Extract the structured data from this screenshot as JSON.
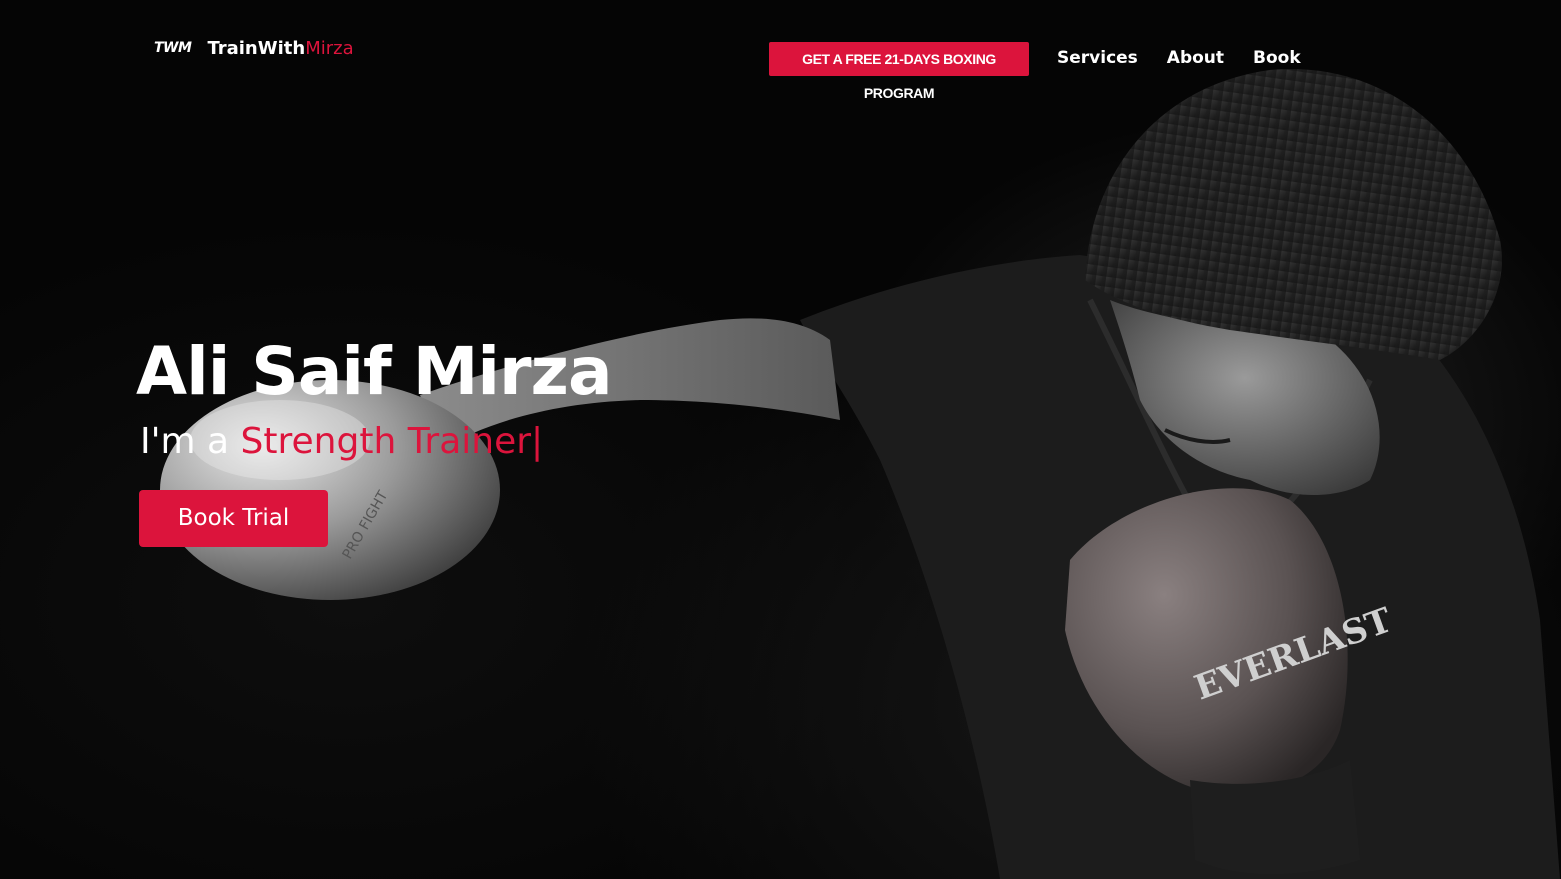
{
  "brand": {
    "mark": "TWM",
    "name_primary": "TrainWith",
    "name_accent": "Mirza"
  },
  "nav": {
    "promo_label": "GET A FREE 21-DAYS BOXING PROGRAM",
    "links": [
      {
        "label": "Services"
      },
      {
        "label": "About"
      },
      {
        "label": "Book"
      }
    ]
  },
  "hero": {
    "title": "Ali Saif Mirza",
    "subtitle_prefix": "I'm a",
    "subtitle_role": "Strength Trainer",
    "cursor": "|",
    "cta_label": "Book Trial"
  },
  "photo": {
    "glove_brand": "EVERLAST",
    "glove_text": "PRO FIGHT"
  },
  "colors": {
    "accent": "#dc143c",
    "background": "#050505",
    "text": "#ffffff"
  },
  "icons": {
    "logo": "twm-logo-icon"
  }
}
